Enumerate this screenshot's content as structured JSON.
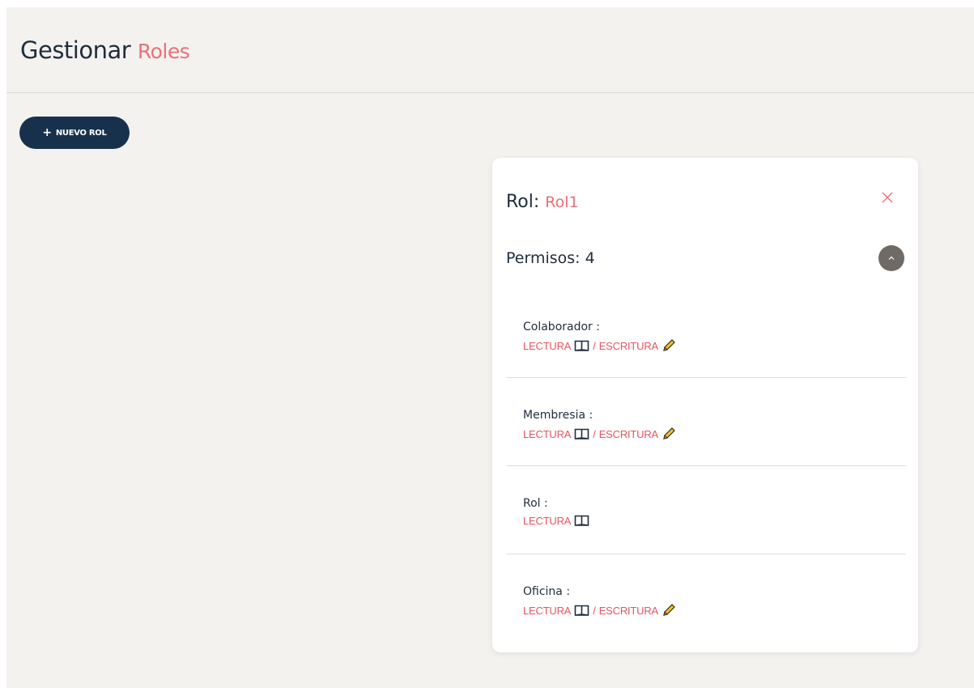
{
  "header": {
    "title_main": "Gestionar",
    "title_accent": "Roles"
  },
  "toolbar": {
    "new_role_label": "NUEVO ROL",
    "new_role_icon": "plus-icon"
  },
  "role_card": {
    "title_label": "Rol:",
    "role_name": "Rol1",
    "close_icon": "close-icon",
    "permissions_label": "Permisos: 4",
    "toggle_icon": "chevron-up-icon",
    "permissions": [
      {
        "name": "Colaborador :",
        "read_label": "LECTURA",
        "separator": "/",
        "write_label": "ESCRITURA"
      },
      {
        "name": "Membresia :",
        "read_label": "LECTURA",
        "separator": "/",
        "write_label": "ESCRITURA"
      },
      {
        "name": "Rol :",
        "read_label": "LECTURA"
      },
      {
        "name": "Oficina :",
        "read_label": "LECTURA",
        "separator": "/",
        "write_label": "ESCRITURA"
      }
    ]
  },
  "colors": {
    "accent": "#ec6f78",
    "primary": "#17314d",
    "background": "#f4f2ef",
    "rights_text": "#e8535f",
    "toggle_bg": "#6f6a65"
  }
}
